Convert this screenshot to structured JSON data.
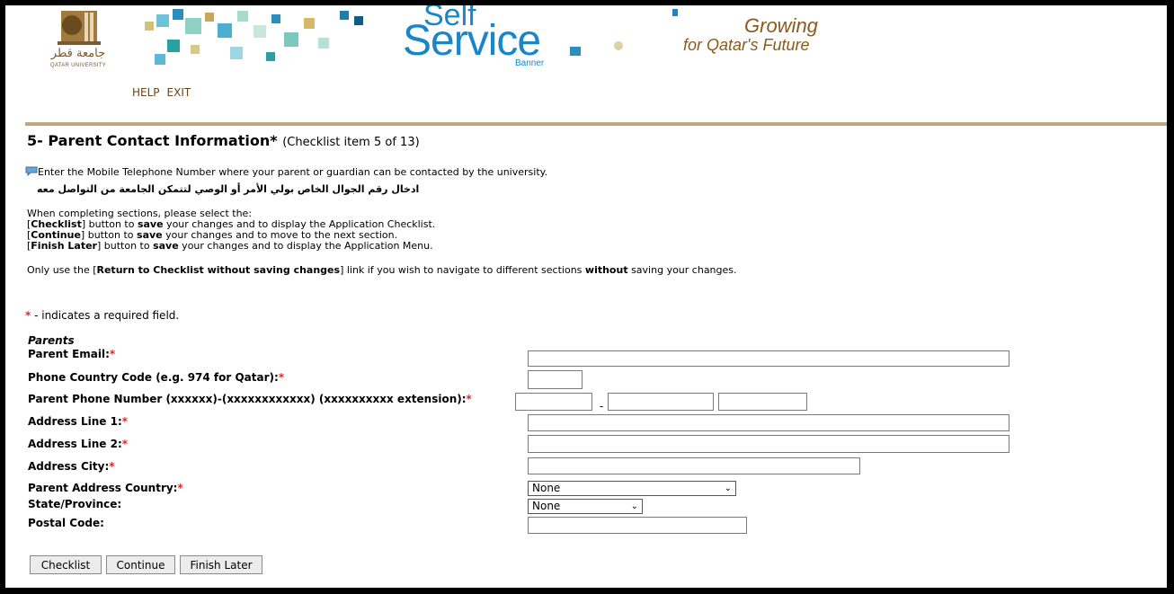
{
  "banner": {
    "logo_arabic": "جامعة قطر",
    "logo_english": "QATAR UNIVERSITY",
    "brand_self": "Self",
    "brand_service": "Service",
    "brand_banner": "Banner",
    "tagline_1": "Growing",
    "tagline_2": "for Qatar's Future"
  },
  "nav": {
    "help": "HELP",
    "exit": "EXIT"
  },
  "title": {
    "main": "5- Parent Contact Information*",
    "sub": "(Checklist item 5 of 13)"
  },
  "info": {
    "line1": "Enter the Mobile Telephone Number where your parent or guardian can be contacted by the university.",
    "line2_arabic": "ادخال رقم الجوال الخاص بولي الأمر أو الوصي لتتمكن الجامعة من التواصل معه",
    "completing": "When completing sections, please select the:",
    "checklist_btn": "Checklist",
    "checklist_rest_a": "] button to ",
    "save": "save",
    "checklist_rest_b": " your changes and to display the Application Checklist.",
    "continue_btn": "Continue",
    "continue_rest_b": " your changes and to move to the next section.",
    "finish_btn": "Finish Later",
    "finish_rest_b": " your changes and to display the Application Menu.",
    "only_use": "Only use the [",
    "return_link": "Return to Checklist without saving changes",
    "only_use_rest": "] link if you wish to navigate to different sections ",
    "without": "without",
    "only_use_end": " saving your changes."
  },
  "required_note": " - indicates a required field.",
  "required_symbol": "*",
  "form": {
    "section": "Parents",
    "parent_email": {
      "label": "Parent Email:",
      "value": ""
    },
    "country_code": {
      "label": "Phone Country Code (e.g. 974 for Qatar):",
      "value": ""
    },
    "phone": {
      "label": "Parent Phone Number (xxxxxx)-(xxxxxxxxxxxx) (xxxxxxxxxx extension):",
      "area": "",
      "number": "",
      "ext": "",
      "sep": "-"
    },
    "address1": {
      "label": "Address Line 1:",
      "value": ""
    },
    "address2": {
      "label": "Address Line 2:",
      "value": ""
    },
    "city": {
      "label": "Address City:",
      "value": ""
    },
    "country": {
      "label": "Parent Address Country:",
      "selected": "None"
    },
    "state": {
      "label": "State/Province:",
      "selected": "None"
    },
    "postal": {
      "label": "Postal Code:",
      "value": ""
    }
  },
  "buttons": {
    "checklist": "Checklist",
    "continue": "Continue",
    "finish": "Finish Later"
  }
}
